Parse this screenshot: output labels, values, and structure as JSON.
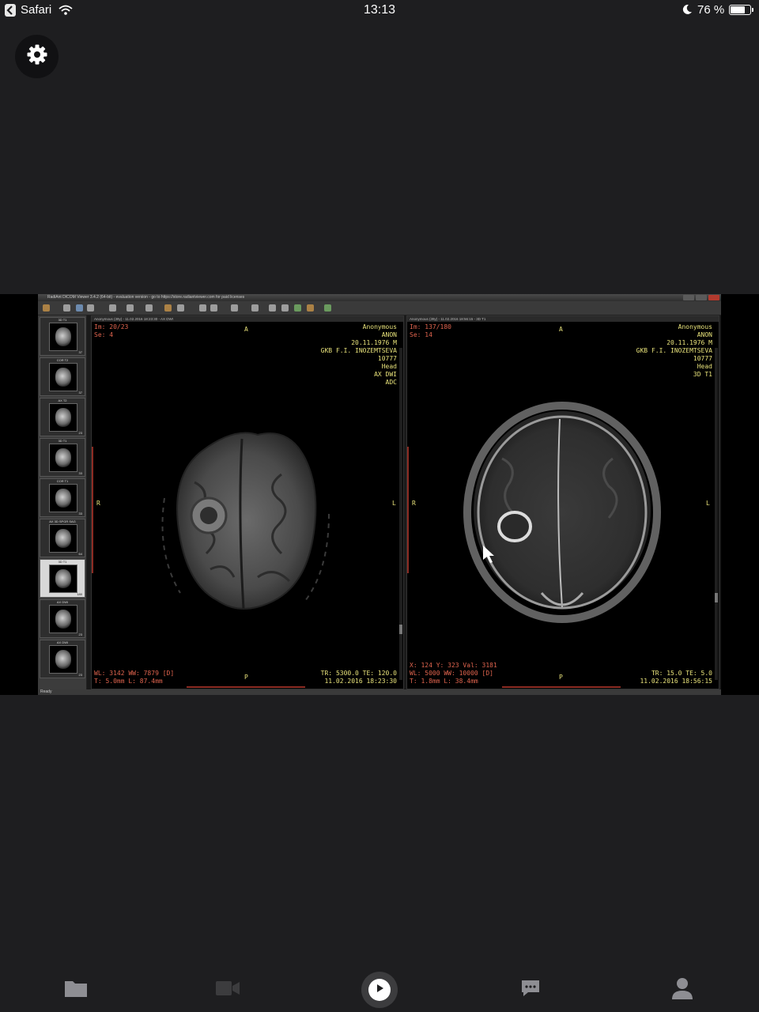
{
  "status_bar": {
    "app_name": "Safari",
    "time": "13:13",
    "battery_percent": "76 %",
    "battery_level": 0.76
  },
  "viewer": {
    "window_title": "RadiAnt DICOM Viewer 3.4.2 (64-bit) - evaluation version - go to https://store.radiantviewer.com for paid licenses",
    "status": "Ready",
    "thumbnails": [
      {
        "label": "3D T1",
        "count": "37"
      },
      {
        "label": "COR T2",
        "count": "37"
      },
      {
        "label": "AX T2",
        "count": "23"
      },
      {
        "label": "3D T1",
        "count": "33"
      },
      {
        "label": "COR T1",
        "count": "33"
      },
      {
        "label": "AX 3D SPGR SAG",
        "count": "64"
      },
      {
        "label": "3D T1",
        "count": "180"
      },
      {
        "label": "AX DWI",
        "count": "23"
      },
      {
        "label": "AX DWI",
        "count": "23"
      }
    ],
    "active_thumbnail": 6,
    "left_viewport": {
      "header": "Anonymous (39y) - 11.02.2016 18:23:30 - AX DWI",
      "image_info": "Im: 20/23\nSe: 4",
      "patient_info": "Anonymous\nANON\n20.11.1976 M\nGKB F.I. INOZEMTSEVA\n10777\nHead\nAX DWI\nADC",
      "orient_top": "A",
      "orient_bottom": "P",
      "orient_left": "R",
      "orient_right": "L",
      "window_info": "WL: 3142 WW: 7879 [D]\nT: 5.0mm L: 87.4mm",
      "acq_info": "TR: 5300.0 TE: 120.0\n11.02.2016 18:23:30"
    },
    "right_viewport": {
      "header": "Anonymous (39y) - 11.02.2016 18:56:15 - 3D T1",
      "image_info": "Im: 137/180\nSe: 14",
      "patient_info": "Anonymous\nANON\n20.11.1976 M\nGKB F.I. INOZEMTSEVA\n10777\nHead\n3D T1",
      "orient_top": "A",
      "orient_bottom": "P",
      "orient_left": "R",
      "orient_right": "L",
      "window_info": "X: 124 Y: 323 Val: 3181\nWL: 5000 WW: 10000 [D]\nT: 1.8mm L: 38.4mm",
      "acq_info": "TR: 15.0 TE: 5.0\n11.02.2016 18:56:15"
    }
  },
  "tabbar": {
    "icons": [
      "folder-icon",
      "video-camera-icon",
      "play-icon",
      "chat-icon",
      "person-icon"
    ],
    "active_color": "#ffffff",
    "inactive_color": "#8e8e93"
  }
}
